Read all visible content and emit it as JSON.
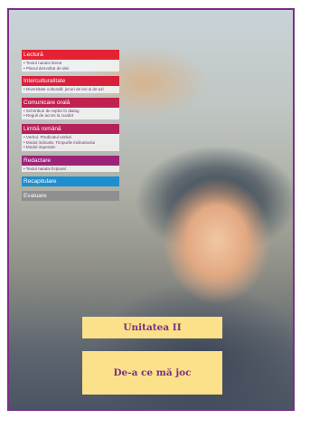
{
  "colors": {
    "border": "#7b2f86",
    "item_text": "#6b3a74",
    "unit_box": "#fbe18a"
  },
  "sections": [
    {
      "title": "Lectură",
      "color": "#e52233",
      "items": [
        "• Textul narativ literar",
        "• Planul dezvoltat de idei"
      ]
    },
    {
      "title": "Interculturalitate",
      "color": "#d8203d",
      "items": [
        "• Diversitate culturală: jocuri de ieri și de azi"
      ]
    },
    {
      "title": "Comunicare orală",
      "color": "#c0224f",
      "items": [
        "• Schimburi de replici în dialog",
        "• Reguli de acces la cuvânt"
      ]
    },
    {
      "title": "Limbă română",
      "color": "#b5225a",
      "items": [
        "• Verbul. Predicatul verbal",
        "• Modul indicativ. Timpurile indicativului",
        "• Modul imperativ"
      ]
    },
    {
      "title": "Redactare",
      "color": "#9b2378",
      "items": [
        "• Textul narativ ficțional"
      ]
    },
    {
      "title": "Recapitulare",
      "color": "#1d8fd0",
      "items": []
    },
    {
      "title": "Evaluare",
      "color": "#8f8f8f",
      "items": []
    }
  ],
  "unit": {
    "label": "Unitatea II",
    "title": "De-a ce mă joc"
  }
}
